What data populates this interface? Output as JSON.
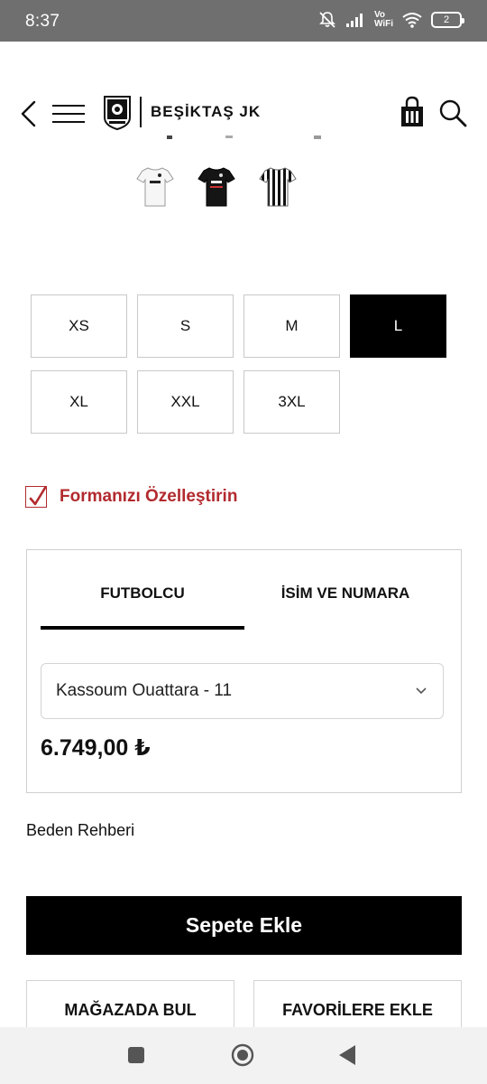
{
  "status_bar": {
    "time": "8:37",
    "vowifi_line1": "Vo",
    "vowifi_line2": "WiFi",
    "battery": "2"
  },
  "header": {
    "brand": "BEŞİKTAŞ JK",
    "icons": [
      "back-icon",
      "menu-icon",
      "besiktas-logo",
      "shopping-bag-icon",
      "search-icon"
    ]
  },
  "colors_variants": [
    "white-jersey",
    "black-jersey",
    "striped-jersey"
  ],
  "sizes": [
    {
      "label": "XS",
      "selected": false
    },
    {
      "label": "S",
      "selected": false
    },
    {
      "label": "M",
      "selected": false
    },
    {
      "label": "L",
      "selected": true
    },
    {
      "label": "XL",
      "selected": false
    },
    {
      "label": "XXL",
      "selected": false
    },
    {
      "label": "3XL",
      "selected": false
    }
  ],
  "customize": {
    "checked": true,
    "label": "Formanızı Özelleştirin",
    "accent_color": "#b22a2e"
  },
  "panel": {
    "tabs": [
      {
        "label": "FUTBOLCU",
        "active": true
      },
      {
        "label": "İSİM VE NUMARA",
        "active": false
      }
    ],
    "player_select_value": "Kassoum Ouattara - 11",
    "price": "6.749,00 ₺"
  },
  "size_guide": "Beden Rehberi",
  "add_to_cart": "Sepete Ekle",
  "secondary_buttons": {
    "find_in_store": "MAĞAZADA BUL",
    "add_to_favorites": "FAVORİLERE EKLE"
  },
  "nav": [
    "recents-icon",
    "home-icon",
    "back-nav-icon"
  ]
}
